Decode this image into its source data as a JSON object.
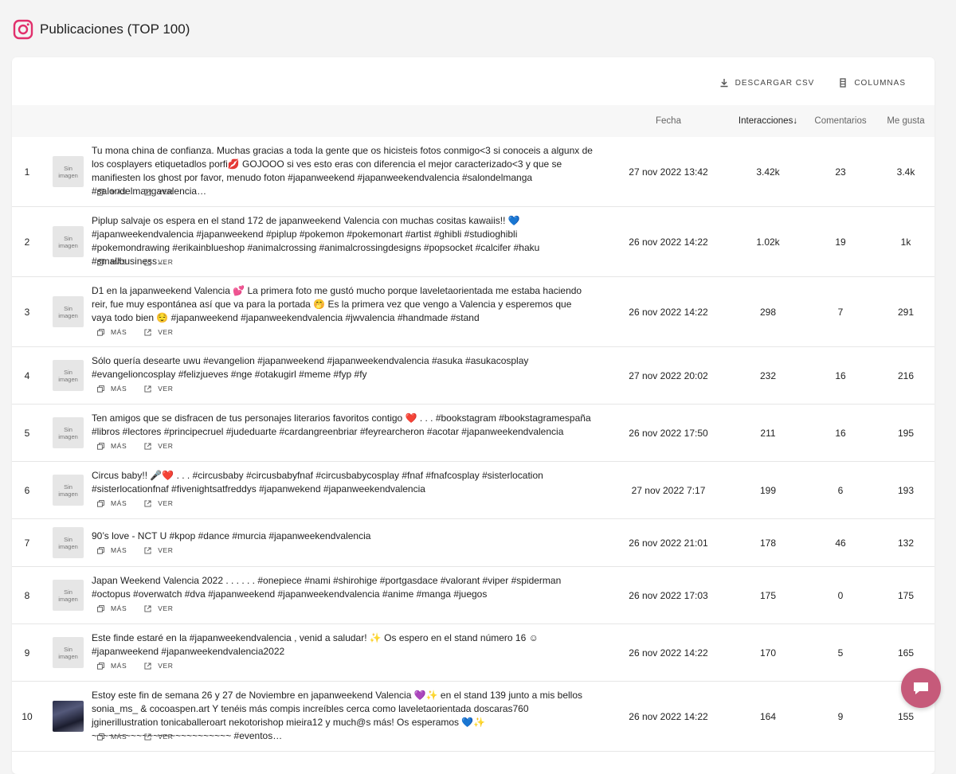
{
  "page": {
    "title": "Publicaciones (TOP 100)"
  },
  "toolbar": {
    "download_label": "DESCARGAR CSV",
    "columns_label": "COLUMNAS"
  },
  "table": {
    "headers": {
      "fecha": "Fecha",
      "interacciones": "Interacciones",
      "sort_arrow": "↓",
      "comentarios": "Comentarios",
      "me_gusta": "Me gusta"
    },
    "action_more": "MÁS",
    "action_view": "VER",
    "thumb_placeholder_1": "Sin",
    "thumb_placeholder_2": "imagen",
    "rows": [
      {
        "idx": "1",
        "text": "Tu mona china de confianza. Muchas gracias a toda la gente que os hicisteis fotos conmigo<3 si conoceis a algunx de los cosplayers etiquetadlos porfi💋 GOJOOO si ves esto eras con diferencia el mejor caracterizado<3 y que se manifiesten los ghost por favor, menudo foton #japanweekend #japanweekendvalencia #salondelmanga #salondelmangavalencia…",
        "date": "27 nov 2022 13:42",
        "interactions": "3.42k",
        "comments": "23",
        "likes": "3.4k"
      },
      {
        "idx": "2",
        "text": "Piplup salvaje os espera en el stand 172 de japanweekend Valencia con muchas cositas kawaiis!! 💙 #japanweekendvalencia #japanweekend #piplup #pokemon #pokemonart #artist #ghibli #studioghibli #pokemondrawing #erikainblueshop #animalcrossing #animalcrossingdesigns #popsocket #calcifer #haku #smallbusiness…",
        "date": "26 nov 2022 14:22",
        "interactions": "1.02k",
        "comments": "19",
        "likes": "1k"
      },
      {
        "idx": "3",
        "text": "D1 en la japanweekend Valencia 💕 La primera foto me gustó mucho porque laveletaorientada me estaba haciendo reir, fue muy espontánea así que va para la portada 🤭 Es la primera vez que vengo a Valencia y esperemos que vaya todo bien 😌 #japanweekend #japanweekendvalencia #jwvalencia #handmade #stand",
        "date": "26 nov 2022 14:22",
        "interactions": "298",
        "comments": "7",
        "likes": "291"
      },
      {
        "idx": "4",
        "text": "Sólo quería desearte uwu #evangelion #japanweekend #japanweekendvalencia #asuka #asukacosplay #evangelioncosplay #felizjueves #nge #otakugirl #meme #fyp #fy",
        "date": "27 nov 2022 20:02",
        "interactions": "232",
        "comments": "16",
        "likes": "216"
      },
      {
        "idx": "5",
        "text": "Ten amigos que se disfracen de tus personajes literarios favoritos contigo ❤️ . . . #bookstagram #bookstagramespaña #libros #lectores #principecruel #judeduarte #cardangreenbriar #feyrearcheron #acotar #japanweekendvalencia",
        "date": "26 nov 2022 17:50",
        "interactions": "211",
        "comments": "16",
        "likes": "195"
      },
      {
        "idx": "6",
        "text": "Circus baby!! 🎤❤️ . . . #circusbaby #circusbabyfnaf #circusbabycosplay #fnaf #fnafcosplay #sisterlocation #sisterlocationfnaf #fivenightsatfreddys #japanwekend #japanweekendvalencia",
        "date": "27 nov 2022 7:17",
        "interactions": "199",
        "comments": "6",
        "likes": "193"
      },
      {
        "idx": "7",
        "text": "90’s love - NCT U #kpop #dance #murcia #japanweekendvalencia",
        "date": "26 nov 2022 21:01",
        "interactions": "178",
        "comments": "46",
        "likes": "132"
      },
      {
        "idx": "8",
        "text": "Japan Weekend Valencia 2022 . . . . . . #onepiece #nami #shirohige #portgasdace #valorant #viper #spiderman #octopus #overwatch #dva #japanweekend #japanweekendvalencia #anime #manga #juegos",
        "date": "26 nov 2022 17:03",
        "interactions": "175",
        "comments": "0",
        "likes": "175"
      },
      {
        "idx": "9",
        "text": "Este finde estaré en la #japanweekendvalencia , venid a saludar! ✨ Os espero en el stand número 16 ☺︎ #japanweekend #japanweekendvalencia2022",
        "date": "26 nov 2022 14:22",
        "interactions": "170",
        "comments": "5",
        "likes": "165"
      },
      {
        "idx": "10",
        "text": "Estoy este fin de semana 26 y 27 de Noviembre en japanweekend Valencia 💜✨ en el stand 139 junto a mis bellos sonia_ms_ & cocoaspen.art Y tenéis más compis increíbles cerca como laveletaorientada doscaras760 jginerillustration tonicaballeroart nekotorishop mieira12 y much@s más! Os esperamos 💙✨ ~~~~~~~~~~~~~~~~~~~~~~~~~ #eventos…",
        "date": "26 nov 2022 14:22",
        "interactions": "164",
        "comments": "9",
        "likes": "155"
      }
    ]
  },
  "colors": {
    "accent": "#c65a7a",
    "instagram": "#e1306c"
  }
}
